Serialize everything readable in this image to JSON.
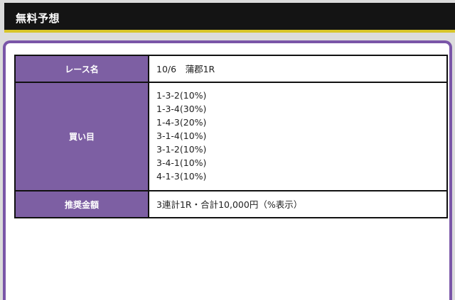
{
  "header": {
    "title": "無料予想"
  },
  "table": {
    "race": {
      "label": "レース名",
      "value": "10/6　蒲郡1R"
    },
    "bets": {
      "label": "買い目",
      "items": [
        "1-3-2(10%)",
        "1-3-4(30%)",
        "1-4-3(20%)",
        "3-1-4(10%)",
        "3-1-2(10%)",
        "3-4-1(10%)",
        "4-1-3(10%)"
      ]
    },
    "amount": {
      "label": "推奨金額",
      "value": "3連計1R・合計10,000円（%表示）"
    }
  },
  "colors": {
    "header_bg": "#141414",
    "header_accent": "#d8c62a",
    "panel_border": "#7a56a8",
    "label_cell_bg": "#7d5fa3"
  }
}
